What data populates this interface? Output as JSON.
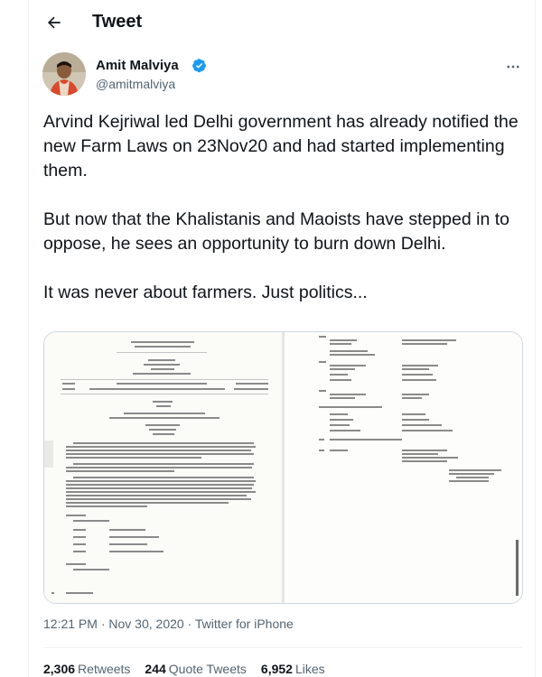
{
  "header": {
    "title": "Tweet",
    "back_icon": "arrow-left-icon"
  },
  "author": {
    "name": "Amit Malviya",
    "handle": "@amitmalviya",
    "verified": true,
    "verified_color": "#1d9bf0"
  },
  "tweet": {
    "paragraphs": [
      "Arvind Kejriwal led Delhi government has already notified the new Farm Laws on 23Nov20 and had started implementing them.",
      "But now that the Khalistanis and Maoists have stepped in to oppose, he sees an opportunity to burn down Delhi.",
      "It was never about farmers. Just politics..."
    ]
  },
  "media": {
    "alt": "Delhi gazette notification document pages"
  },
  "meta": {
    "time": "12:21 PM",
    "separator": "·",
    "date": "Nov 30, 2020",
    "source": "Twitter for iPhone"
  },
  "stats": {
    "retweets_count": "2,306",
    "retweets_label": "Retweets",
    "quotes_count": "244",
    "quotes_label": "Quote Tweets",
    "likes_count": "6,952",
    "likes_label": "Likes"
  }
}
